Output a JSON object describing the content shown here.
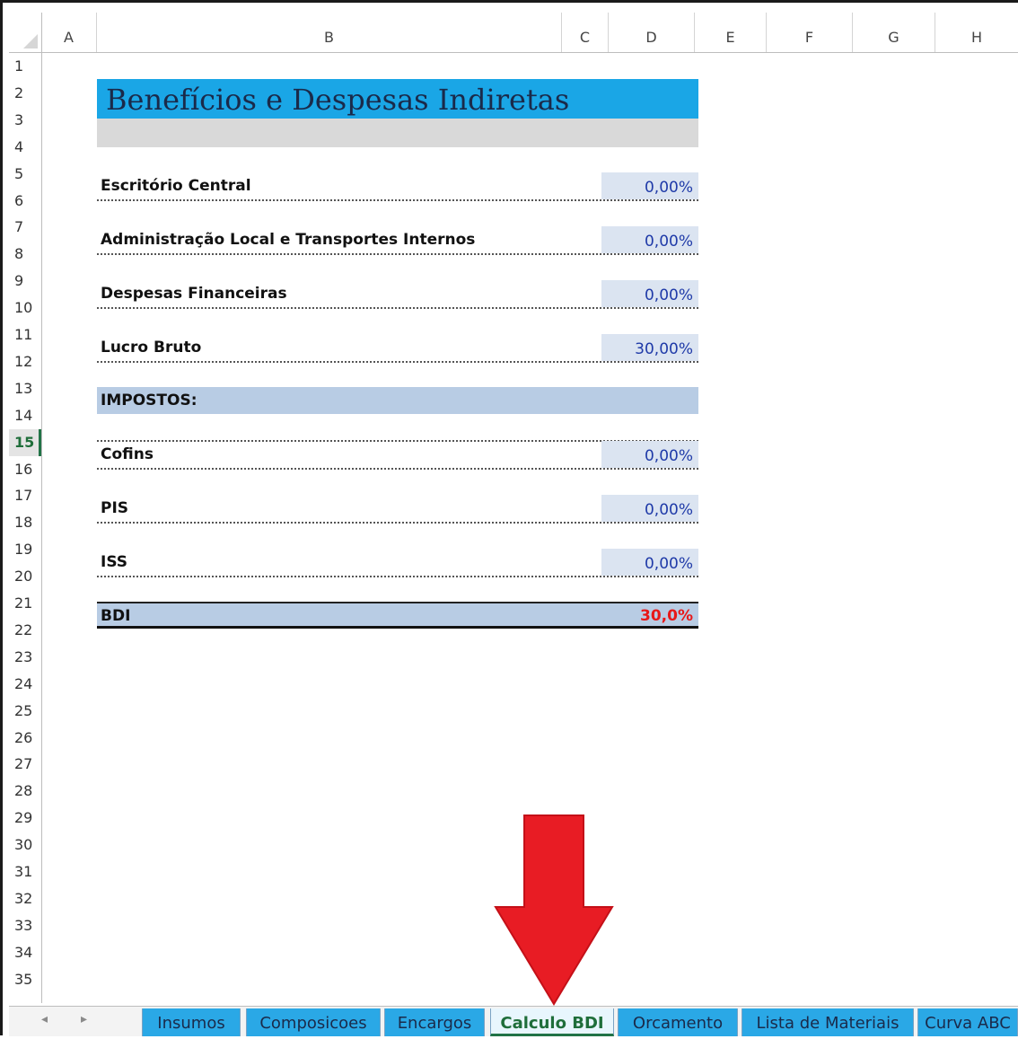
{
  "columns": [
    "A",
    "B",
    "C",
    "D",
    "E",
    "F",
    "G",
    "H"
  ],
  "rows": [
    "1",
    "2",
    "3",
    "4",
    "5",
    "6",
    "7",
    "8",
    "9",
    "10",
    "11",
    "12",
    "13",
    "14",
    "15",
    "16",
    "17",
    "18",
    "19",
    "20",
    "21",
    "22",
    "23",
    "24",
    "25",
    "26",
    "27",
    "28",
    "29",
    "30",
    "31",
    "32",
    "33",
    "34",
    "35"
  ],
  "active_row": "15",
  "sheet": {
    "title": "Benefícios e Despesas Indiretas",
    "items": [
      {
        "label": "Escritório Central",
        "value": "0,00%"
      },
      {
        "label": "Administração Local e Transportes Internos",
        "value": "0,00%"
      },
      {
        "label": "Despesas Financeiras",
        "value": "0,00%"
      },
      {
        "label": "Lucro Bruto",
        "value": "30,00%"
      }
    ],
    "impostos_header": "IMPOSTOS:",
    "taxes": [
      {
        "label": "Cofins",
        "value": "0,00%"
      },
      {
        "label": "PIS",
        "value": "0,00%"
      },
      {
        "label": "ISS",
        "value": "0,00%"
      }
    ],
    "bdi_label": "BDI",
    "bdi_value": "30,0%"
  },
  "nav": {
    "prev": "◂",
    "next": "▸"
  },
  "tabs": [
    "Insumos",
    "Composicoes",
    "Encargos",
    "Calculo BDI",
    "Orcamento",
    "Lista de Materiais",
    "Curva ABC"
  ],
  "active_tab": "Calculo BDI",
  "colors": {
    "title_bar": "#1aa6e6",
    "section_fill": "#b8cce4",
    "value_fill": "#dbe4f1",
    "bdi_value": "#e81818",
    "tab_fill": "#2aa8e6",
    "arrow": "#e81c24"
  },
  "annotation": {
    "arrow_icon": "red-arrow-down-icon"
  }
}
